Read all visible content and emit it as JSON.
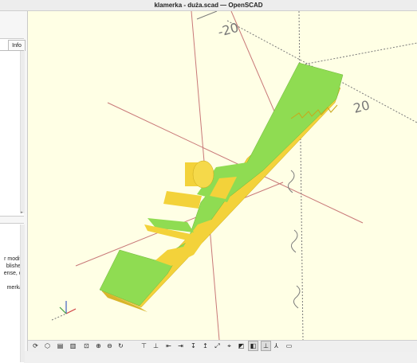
{
  "window": {
    "title": "klamerka - duża.scad — OpenSCAD"
  },
  "left_panel": {
    "tab_label": "Info",
    "console_lines": [
      "r modify",
      "blished",
      "ense, or",
      "",
      "merka/"
    ]
  },
  "viewport": {
    "axis_labels": [
      "-20",
      "20"
    ],
    "colors": {
      "background": "#ffffe5",
      "top_face": "#8fdc52",
      "side_face": "#f3d23a",
      "axis": "#c87878",
      "dashed_axis": "#7a7a7a"
    }
  },
  "toolbar": {
    "buttons": [
      {
        "name": "preview",
        "icon": "preview-icon",
        "glyph": "⟳"
      },
      {
        "name": "render",
        "icon": "render-icon",
        "glyph": "⬡"
      },
      {
        "name": "export-stl",
        "icon": "export-stl-icon",
        "glyph": "▤"
      },
      {
        "name": "export-dxf",
        "icon": "export-dxf-icon",
        "glyph": "▥"
      },
      {
        "name": "view-all",
        "icon": "view-all-icon",
        "glyph": "⊡"
      },
      {
        "name": "zoom-in",
        "icon": "zoom-in-icon",
        "glyph": "⊕"
      },
      {
        "name": "zoom-out",
        "icon": "zoom-out-icon",
        "glyph": "⊖"
      },
      {
        "name": "reset-view",
        "icon": "reset-view-icon",
        "glyph": "↻"
      },
      {
        "name": "view-top",
        "icon": "view-top-icon",
        "glyph": "⊤"
      },
      {
        "name": "view-bottom",
        "icon": "view-bottom-icon",
        "glyph": "⊥"
      },
      {
        "name": "view-left",
        "icon": "view-left-icon",
        "glyph": "⇤"
      },
      {
        "name": "view-right",
        "icon": "view-right-icon",
        "glyph": "⇥"
      },
      {
        "name": "view-front",
        "icon": "view-front-icon",
        "glyph": "↧"
      },
      {
        "name": "view-back",
        "icon": "view-back-icon",
        "glyph": "↥"
      },
      {
        "name": "view-diagonal",
        "icon": "view-diagonal-icon",
        "glyph": "⤢"
      },
      {
        "name": "view-center",
        "icon": "view-center-icon",
        "glyph": "⌖"
      },
      {
        "name": "perspective",
        "icon": "perspective-icon",
        "glyph": "◩"
      },
      {
        "name": "orthogonal",
        "icon": "orthogonal-icon",
        "glyph": "◧"
      },
      {
        "name": "show-axes",
        "icon": "show-axes-icon",
        "glyph": "⊥"
      },
      {
        "name": "show-scale",
        "icon": "show-scale-icon",
        "glyph": "⅄"
      },
      {
        "name": "show-edges",
        "icon": "show-edges-icon",
        "glyph": "▭"
      }
    ]
  }
}
